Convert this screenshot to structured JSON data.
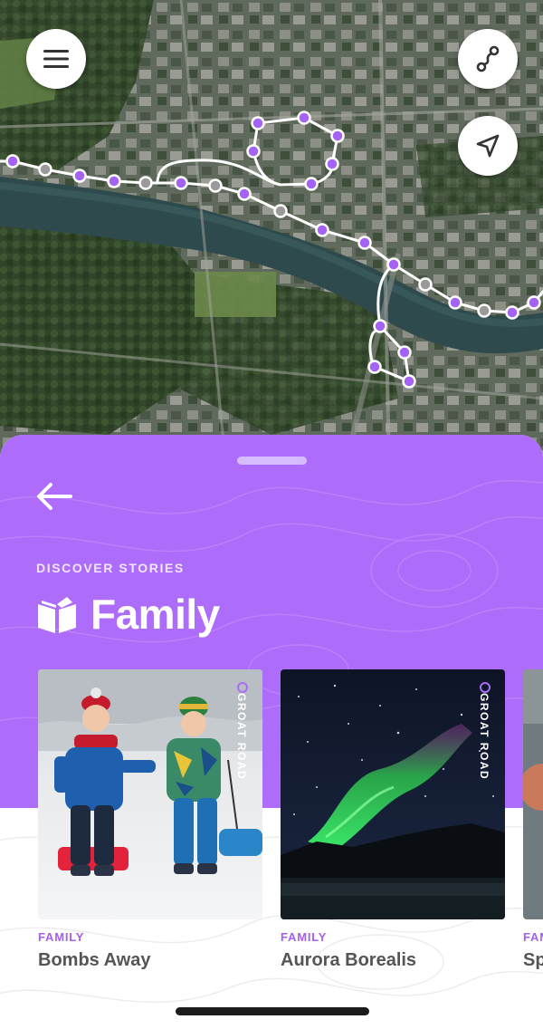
{
  "map": {
    "menu_icon": "hamburger-icon",
    "route_icon": "route-icon",
    "locate_icon": "navigation-arrow-icon",
    "route_color": "#a463f4",
    "route_gray_color": "#9a9a9a"
  },
  "sheet": {
    "back_icon": "arrow-left-icon",
    "eyebrow": "DISCOVER STORIES",
    "category_icon": "open-book-icon",
    "title": "Family",
    "accent": "#ae6cfa"
  },
  "cards": [
    {
      "tag": "GROAT ROAD",
      "category": "FAMILY",
      "title": "Bombs Away"
    },
    {
      "tag": "GROAT ROAD",
      "category": "FAMILY",
      "title": "Aurora Borealis"
    },
    {
      "tag": "",
      "category": "FAM",
      "title": "Sp"
    }
  ]
}
